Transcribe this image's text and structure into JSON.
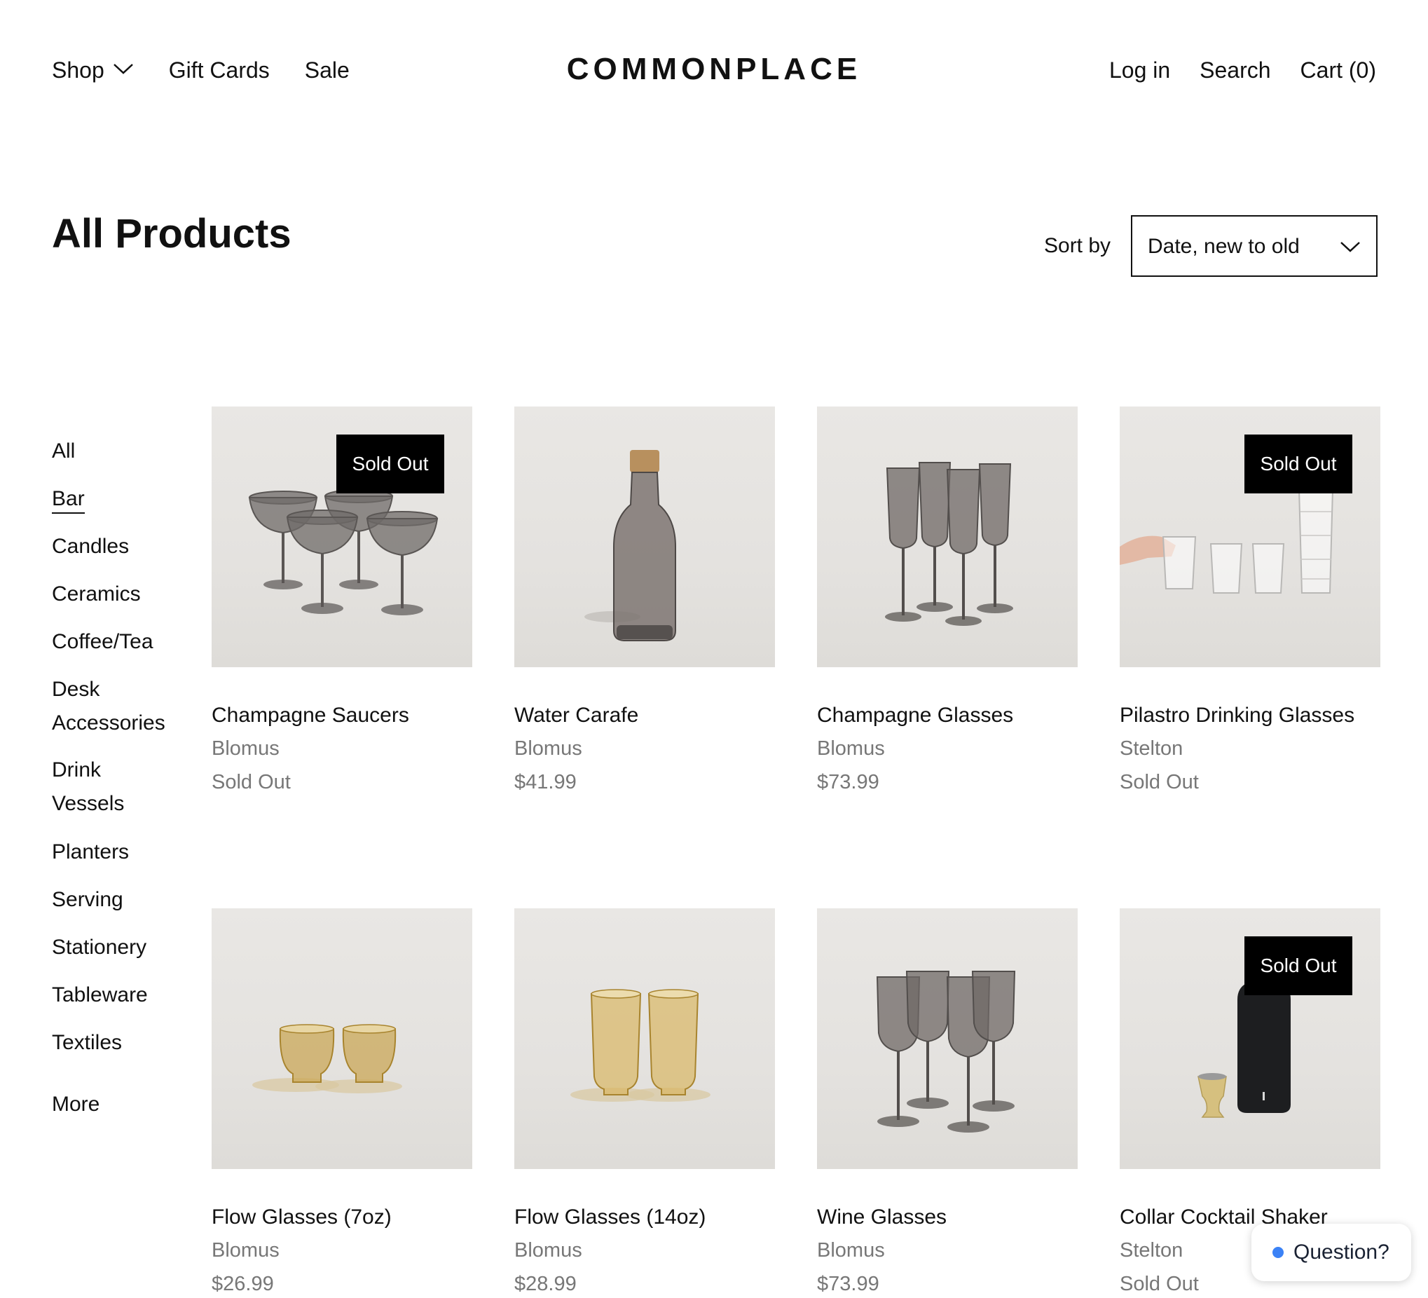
{
  "header": {
    "nav_left": {
      "shop": "Shop",
      "gift_cards": "Gift Cards",
      "sale": "Sale"
    },
    "logo": "COMMONPLACE",
    "nav_right": {
      "login": "Log in",
      "search": "Search",
      "cart": "Cart (0)"
    }
  },
  "page": {
    "title": "All Products",
    "sort_label": "Sort by",
    "sort_value": "Date, new to old"
  },
  "sidebar": {
    "items": [
      {
        "label": "All"
      },
      {
        "label": "Bar",
        "active": true
      },
      {
        "label": "Candles"
      },
      {
        "label": "Ceramics"
      },
      {
        "label": "Coffee/Tea"
      },
      {
        "label": "Desk Accessories"
      },
      {
        "label": "Drink Vessels"
      },
      {
        "label": "Planters"
      },
      {
        "label": "Serving"
      },
      {
        "label": "Stationery"
      },
      {
        "label": "Tableware"
      },
      {
        "label": "Textiles"
      }
    ],
    "more": "More"
  },
  "products": [
    {
      "name": "Champagne Saucers",
      "vendor": "Blomus",
      "price": "Sold Out",
      "badge": "Sold Out",
      "image": "smoke-champagne-saucers"
    },
    {
      "name": "Water Carafe",
      "vendor": "Blomus",
      "price": "$41.99",
      "image": "smoke-carafe-with-cork"
    },
    {
      "name": "Champagne Glasses",
      "vendor": "Blomus",
      "price": "$73.99",
      "image": "smoke-champagne-flutes"
    },
    {
      "name": "Pilastro Drinking Glasses",
      "vendor": "Stelton",
      "price": "Sold Out",
      "badge": "Sold Out",
      "image": "clear-ribbed-glasses"
    },
    {
      "name": "Flow Glasses (7oz)",
      "vendor": "Blomus",
      "price": "$26.99",
      "image": "amber-short-glasses"
    },
    {
      "name": "Flow Glasses (14oz)",
      "vendor": "Blomus",
      "price": "$28.99",
      "image": "amber-tall-glasses"
    },
    {
      "name": "Wine Glasses",
      "vendor": "Blomus",
      "price": "$73.99",
      "image": "smoke-wine-glasses"
    },
    {
      "name": "Collar Cocktail Shaker",
      "vendor": "Stelton",
      "price": "Sold Out",
      "badge": "Sold Out",
      "image": "black-cocktail-shaker-brass-jigger"
    }
  ],
  "chat": {
    "label": "Question?",
    "dot_color": "#3b82f6"
  },
  "colors": {
    "text": "#111111",
    "muted": "#777777",
    "badge_bg": "#000000",
    "image_bg": "#e7e5e2"
  }
}
